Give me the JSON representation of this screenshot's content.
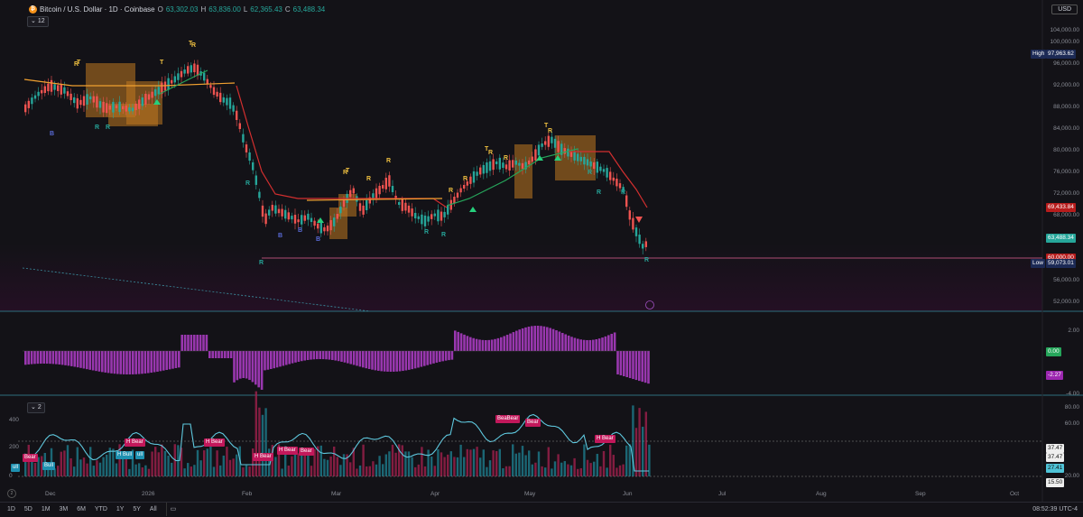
{
  "header": {
    "symbol": "Bitcoin / U.S. Dollar · 1D · Coinbase",
    "o_key": "O",
    "o_val": "63,302.03",
    "h_key": "H",
    "h_val": "63,836.00",
    "l_key": "L",
    "l_val": "62,365.43",
    "c_key": "C",
    "c_val": "63,488.34",
    "indicator_count_top": "12",
    "indicator_count_bottom": "2"
  },
  "currency": "USD",
  "price_axis": [
    "104,000.00",
    "100,000.00",
    "96,000.00",
    "92,000.00",
    "88,000.00",
    "84,000.00",
    "80,000.00",
    "76,000.00",
    "72,000.00",
    "68,000.00",
    "56,000.00",
    "52,000.00"
  ],
  "price_tags": {
    "high_label": "High",
    "high_value": "97,963.62",
    "red_value": "69,433.84",
    "teal_value": "63,488.34",
    "red2_value": "60,000.00",
    "low_label": "Low",
    "low_value": "59,073.01"
  },
  "osc_axis": {
    "top": "2.00",
    "bottom": "-4.00"
  },
  "osc_tags": {
    "zero": "0.00",
    "current": "-2.27"
  },
  "rsi_axis": {
    "top": "80.00",
    "mid": "60.00",
    "bottom": "20.00"
  },
  "rsi_tags": {
    "a": "37.47",
    "b": "37.47",
    "c": "27.41",
    "d": "15.50"
  },
  "vol_axis": {
    "top": "400",
    "mid": "200",
    "bottom": "0"
  },
  "div_labels": {
    "h_bear_1": "H Bear",
    "h_bear_2": "H Bear",
    "h_bear_3": "H Bear",
    "h_bear_4": "H Bear",
    "h_bear_5": "H Bear",
    "bear_1": "Bear",
    "bear_2": "Bear",
    "bear_3": "BeaBear",
    "h_bull": "H Bull",
    "bull": "Bull",
    "ull_1": "ull",
    "ull_2": "ull"
  },
  "time_axis": [
    "Dec",
    "2026",
    "Feb",
    "Mar",
    "Apr",
    "May",
    "Jun",
    "Jul",
    "Aug",
    "Sep",
    "Oct"
  ],
  "toolbar": {
    "ranges": [
      "1D",
      "5D",
      "1M",
      "3M",
      "6M",
      "YTD",
      "1Y",
      "5Y",
      "All"
    ],
    "clock": "08:52:39 UTC-4"
  },
  "signals": {
    "b": "B",
    "r": "R",
    "t": "T"
  },
  "colors": {
    "bg": "#131217",
    "up": "#26a69a",
    "down": "#ef5350",
    "orange": "#f0a030",
    "purple": "#b040c0",
    "cyan": "#4fc3d7",
    "red_line": "#d32f2f"
  }
}
